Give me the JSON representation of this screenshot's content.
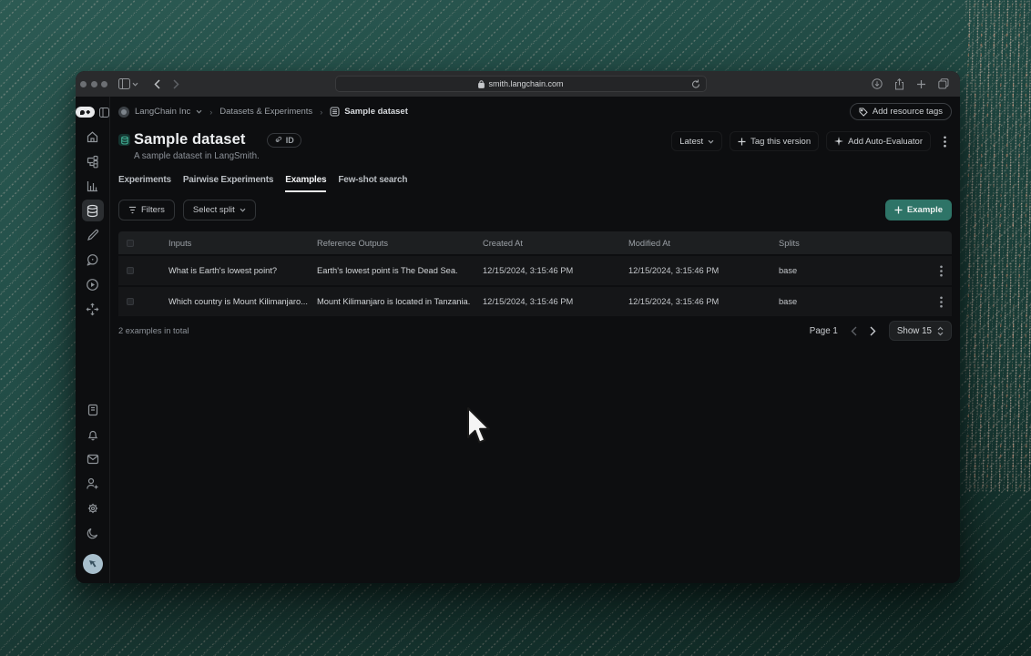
{
  "browser": {
    "url": "smith.langchain.com"
  },
  "breadcrumb": {
    "org": "LangChain Inc",
    "section": "Datasets & Experiments",
    "page": "Sample dataset"
  },
  "topbar": {
    "add_resource_tags": "Add resource tags"
  },
  "header": {
    "title": "Sample dataset",
    "subtitle": "A sample dataset in LangSmith.",
    "id_label": "ID",
    "latest_label": "Latest",
    "tag_version_label": "Tag this version",
    "auto_evaluator_label": "Add Auto-Evaluator"
  },
  "tabs": [
    {
      "label": "Experiments"
    },
    {
      "label": "Pairwise Experiments"
    },
    {
      "label": "Examples"
    },
    {
      "label": "Few-shot search"
    }
  ],
  "toolbar": {
    "filters_label": "Filters",
    "select_split_label": "Select split",
    "add_example_label": "Example"
  },
  "table": {
    "columns": [
      "Inputs",
      "Reference Outputs",
      "Created At",
      "Modified At",
      "Splits"
    ],
    "rows": [
      {
        "inputs": "What is Earth's lowest point?",
        "reference_outputs": "Earth's lowest point is The Dead Sea.",
        "created_at": "12/15/2024, 3:15:46 PM",
        "modified_at": "12/15/2024, 3:15:46 PM",
        "splits": "base"
      },
      {
        "inputs": "Which country is Mount Kilimanjaro...",
        "reference_outputs": "Mount Kilimanjaro is located in Tanzania.",
        "created_at": "12/15/2024, 3:15:46 PM",
        "modified_at": "12/15/2024, 3:15:46 PM",
        "splits": "base"
      }
    ]
  },
  "footer": {
    "total": "2 examples in total",
    "page": "Page 1",
    "show": "Show 15"
  },
  "colors": {
    "accent": "#2e7467",
    "desktop_base": "#27504a"
  }
}
